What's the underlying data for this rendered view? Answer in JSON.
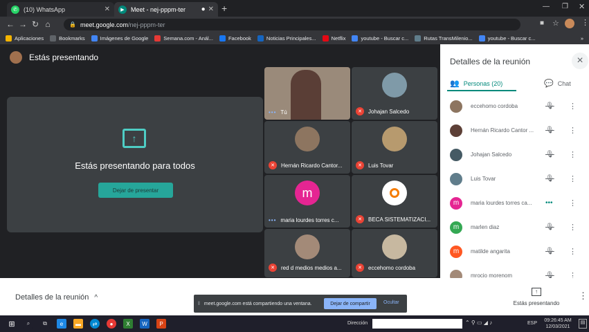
{
  "browser": {
    "tabs": [
      {
        "title": "(10) WhatsApp",
        "icon": "whatsapp-icon",
        "color": "#25d366",
        "active": false
      },
      {
        "title": "Meet - nej-pppm-ter",
        "icon": "meet-icon",
        "color": "#00897b",
        "active": true
      }
    ],
    "new_tab": "+",
    "url_host": "meet.google.com",
    "url_path": "/nej-pppm-ter",
    "bookmarks": [
      {
        "label": "Aplicaciones",
        "icon": "apps-grid-icon",
        "color": "#f4b400"
      },
      {
        "label": "Bookmarks",
        "icon": "star-icon",
        "color": "#5f6368"
      },
      {
        "label": "Imágenes de Google",
        "icon": "google-icon",
        "color": "#4285f4"
      },
      {
        "label": "Semana.com - Anál...",
        "icon": "semana-icon",
        "color": "#e53935"
      },
      {
        "label": "Facebook",
        "icon": "facebook-icon",
        "color": "#1877f2"
      },
      {
        "label": "Noticias Principales...",
        "icon": "news-icon",
        "color": "#1565c0"
      },
      {
        "label": "Netflix",
        "icon": "netflix-icon",
        "color": "#e50914"
      },
      {
        "label": "youtube - Buscar c...",
        "icon": "google-icon",
        "color": "#4285f4"
      },
      {
        "label": "Rutas TransMilenio...",
        "icon": "transmilenio-icon",
        "color": "#607d8b"
      },
      {
        "label": "youtube - Buscar c...",
        "icon": "google-icon",
        "color": "#4285f4"
      }
    ],
    "more": "»"
  },
  "meet": {
    "presenting_label": "Estás presentando",
    "present_card": {
      "title": "Estás presentando para todos",
      "stop_button": "Dejar de presentar",
      "icon": "present-to-all-icon"
    },
    "tiles": [
      {
        "name": "Tú",
        "muted": false,
        "speaking": true
      },
      {
        "name": "Johajan Salcedo",
        "muted": true
      },
      {
        "name": "Hernán Ricardo Cantor...",
        "muted": true
      },
      {
        "name": "Luis Tovar",
        "muted": true
      },
      {
        "name": "maria lourdes torres c...",
        "muted": false,
        "speaking": true,
        "initial": "m",
        "color": "#e52592"
      },
      {
        "name": "BECA SISTEMATIZACI...",
        "muted": true
      },
      {
        "name": "red d medios medios a...",
        "muted": true
      },
      {
        "name": "eccehomo cordoba",
        "muted": true
      }
    ],
    "panel": {
      "title": "Detalles de la reunión",
      "close": "×",
      "tab_people": "Personas (20)",
      "tab_chat": "Chat",
      "people": [
        {
          "name": "eccehomo cordoba",
          "muted": true
        },
        {
          "name": "Hernán Ricardo Cantor ...",
          "muted": true
        },
        {
          "name": "Johajan Salcedo",
          "muted": true
        },
        {
          "name": "Luis Tovar",
          "muted": true
        },
        {
          "name": "maria lourdes torres ca...",
          "muted": false,
          "initial": "m",
          "color": "#e52592"
        },
        {
          "name": "marlen diaz",
          "muted": true,
          "initial": "m",
          "color": "#34a853"
        },
        {
          "name": "matilde angarita",
          "muted": true,
          "initial": "m",
          "color": "#ff5722"
        },
        {
          "name": "mrocio morenom",
          "muted": true
        }
      ]
    },
    "bottom": {
      "details_label": "Detalles de la reunión",
      "presenting_label": "Estás presentando",
      "chevron": "^"
    },
    "share_banner": {
      "text": "meet.google.com está compartiendo una ventana.",
      "stop_button": "Dejar de compartir",
      "hide_button": "Ocultar"
    }
  },
  "taskbar": {
    "address_label": "Dirección",
    "lang": "ESP",
    "time": "09:26:45 AM",
    "date": "12/03/2021"
  }
}
